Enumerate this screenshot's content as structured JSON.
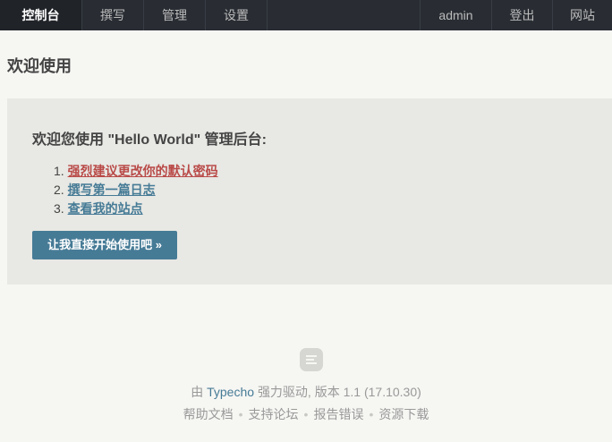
{
  "nav": {
    "left": [
      "控制台",
      "撰写",
      "管理",
      "设置"
    ],
    "right": [
      "admin",
      "登出",
      "网站"
    ]
  },
  "page_title": "欢迎使用",
  "welcome": {
    "heading": "欢迎您使用 \"Hello World\" 管理后台:",
    "items": [
      {
        "num": "1.",
        "label": "强烈建议更改你的默认密码"
      },
      {
        "num": "2.",
        "label": "撰写第一篇日志"
      },
      {
        "num": "3.",
        "label": "查看我的站点"
      }
    ],
    "button_label": "让我直接开始使用吧 »"
  },
  "footer": {
    "by": "由",
    "brand": "Typecho",
    "powered": "强力驱动, 版本 1.1 (17.10.30)",
    "links": [
      "帮助文档",
      "支持论坛",
      "报告错误",
      "资源下载"
    ],
    "separator": "•"
  },
  "colors": {
    "nav_bg": "#292d33",
    "accent": "#467b96",
    "warning_link": "#b94a48"
  },
  "icons": {
    "footer_logo": "typecho-logo-icon"
  }
}
